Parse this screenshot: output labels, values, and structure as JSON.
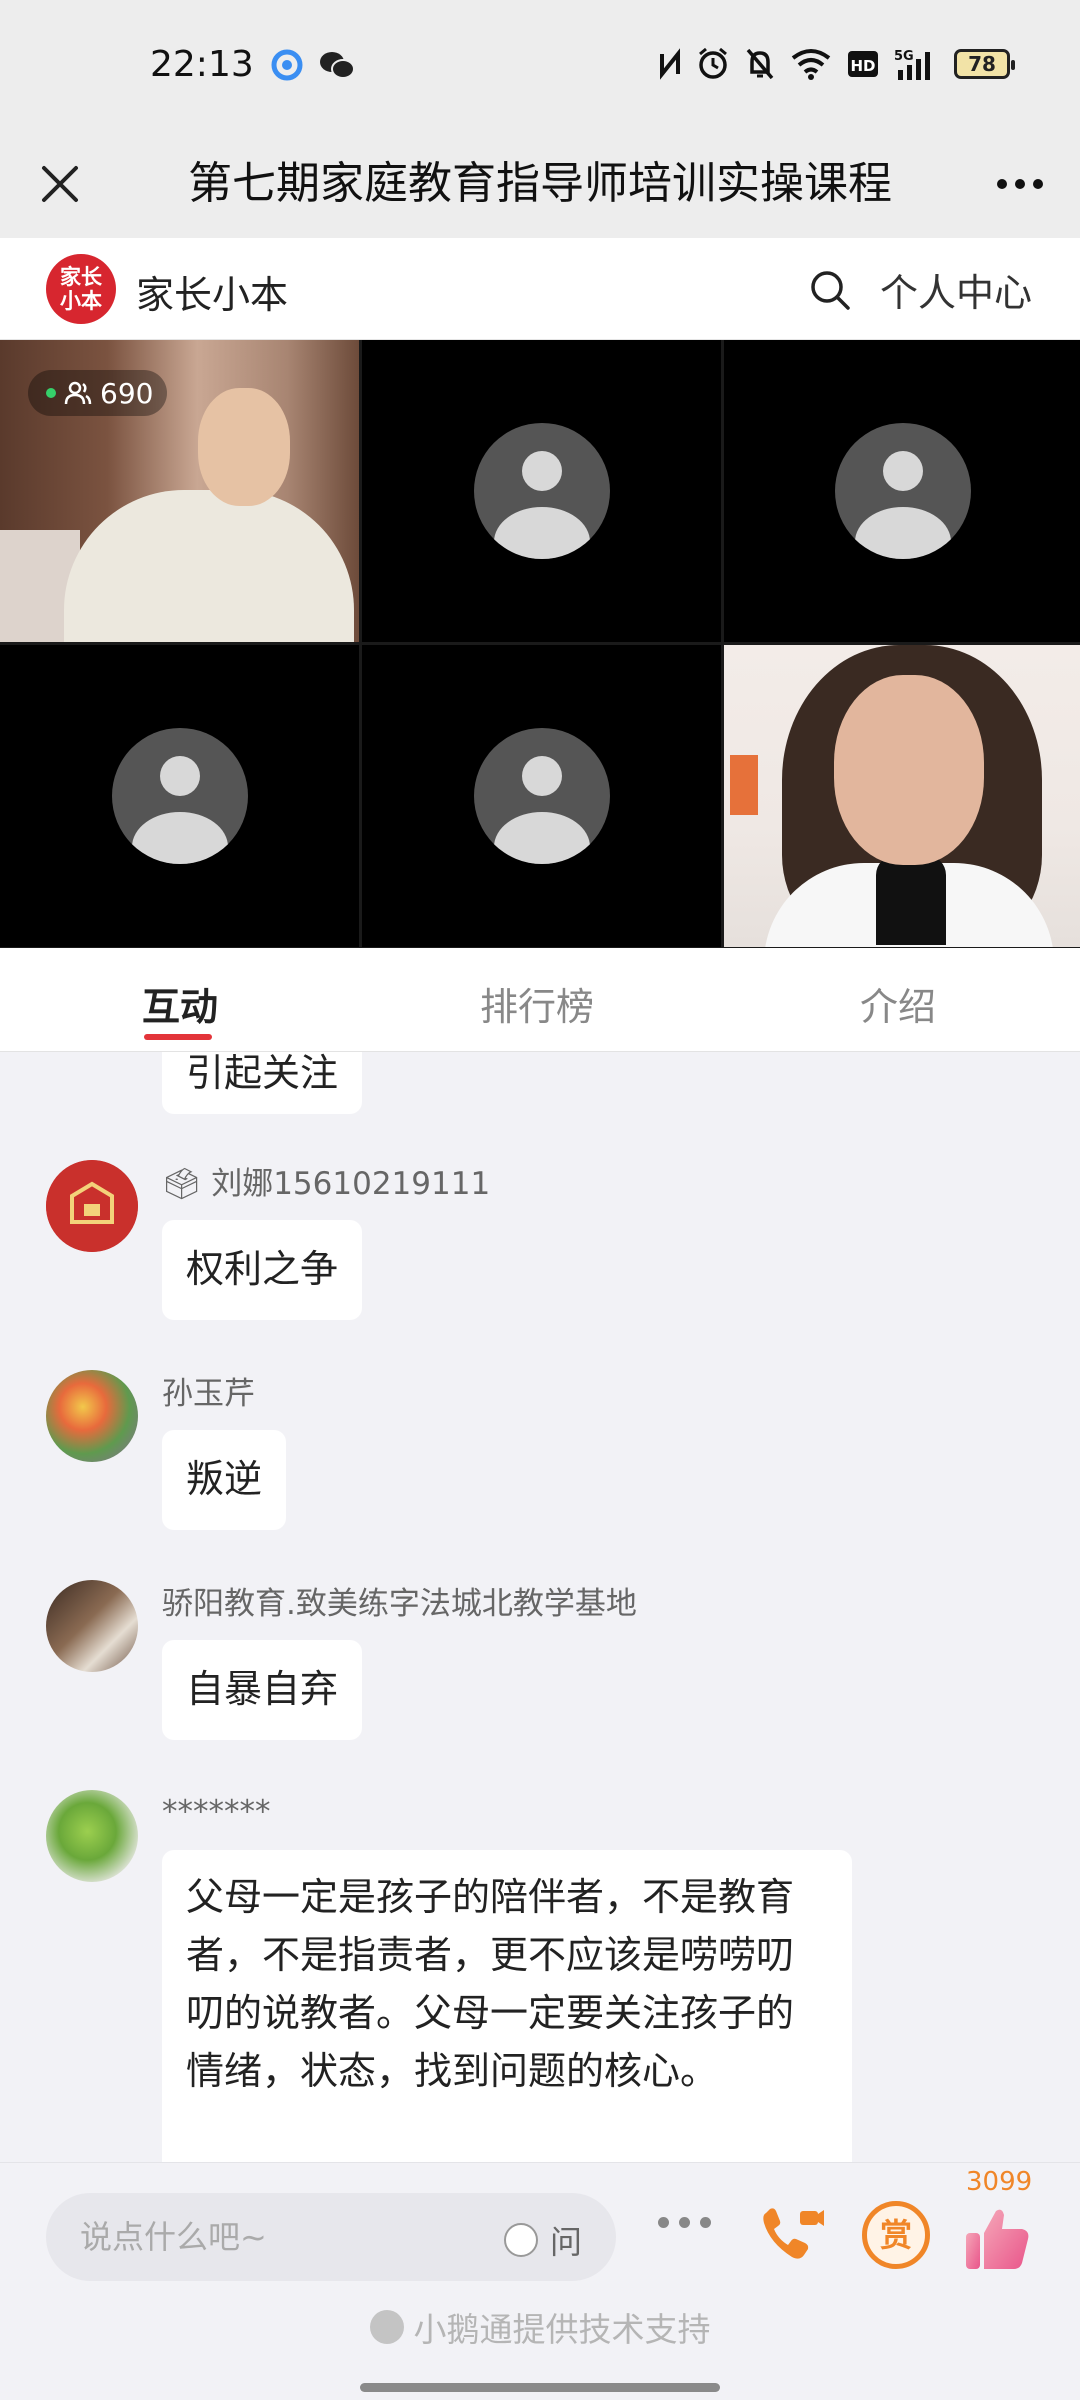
{
  "status_bar": {
    "time": "22:13",
    "battery": "78",
    "icons": [
      "qq-browser-icon",
      "wechat-icon",
      "nfc-icon",
      "alarm-icon",
      "mute-icon",
      "wifi-icon",
      "hd-icon",
      "5g-signal-icon",
      "battery-icon"
    ]
  },
  "title_bar": {
    "title": "第七期家庭教育指导师培训实操课程"
  },
  "brand": {
    "logo_text": "家长小本",
    "name": "家长小本",
    "personal_center": "个人中心"
  },
  "video": {
    "viewer_count": "690",
    "tiles": [
      "host",
      "placeholder",
      "placeholder",
      "placeholder",
      "placeholder",
      "speaker"
    ]
  },
  "tabs": [
    {
      "label": "互动",
      "active": true
    },
    {
      "label": "排行榜",
      "active": false
    },
    {
      "label": "介绍",
      "active": false
    }
  ],
  "chat": {
    "partial_message": "引起关注",
    "messages": [
      {
        "user": "🗳 刘娜15610219111",
        "text": "权利之争"
      },
      {
        "user": "孙玉芹",
        "text": "叛逆"
      },
      {
        "user": "骄阳教育.致美练字法城北教学基地",
        "text": "自暴自弃"
      },
      {
        "user": "*******",
        "lines": [
          "父母一定是孩子的陪伴者，不是教育",
          "者，不是指责者，更不应该是唠唠叨",
          "叨的说教者。父母一定要关注孩子的",
          "情绪，状态，找到问题的核心。"
        ]
      }
    ]
  },
  "bottom_bar": {
    "input_placeholder": "说点什么吧~",
    "ask_label": "问",
    "reward_label": "赏",
    "like_count": "3099",
    "tech_support": "小鹅通提供技术支持"
  },
  "colors": {
    "accent_red": "#e3343a",
    "brand_red": "#d7262f",
    "reward_orange": "#f08628"
  }
}
